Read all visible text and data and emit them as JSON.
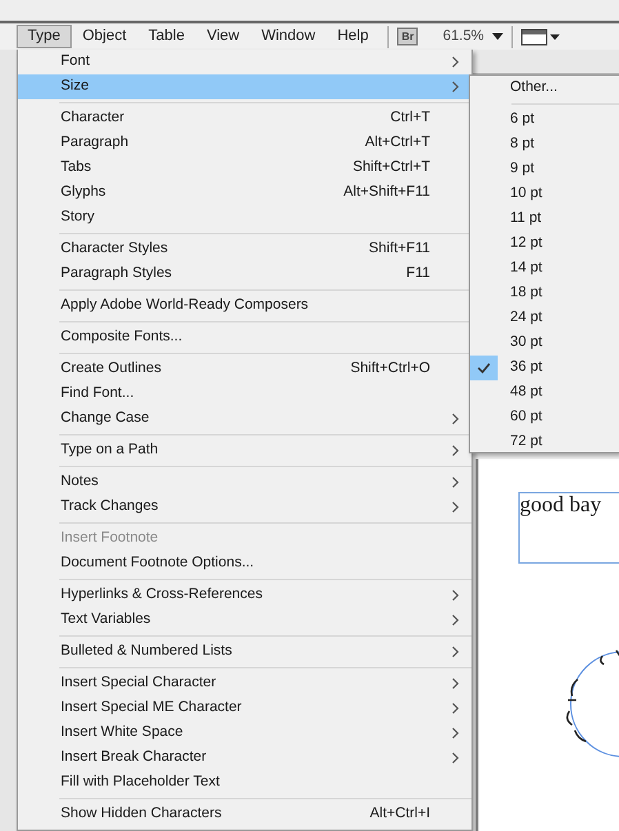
{
  "menubar": [
    {
      "label": "Type",
      "selected": true
    },
    {
      "label": "Object",
      "selected": false
    },
    {
      "label": "Table",
      "selected": false
    },
    {
      "label": "View",
      "selected": false
    },
    {
      "label": "Window",
      "selected": false
    },
    {
      "label": "Help",
      "selected": false
    }
  ],
  "toolbar": {
    "bridge_button": "Br",
    "zoom": "61.5%"
  },
  "menu": [
    {
      "kind": "item",
      "label": "Font",
      "submenu": true,
      "selected": false
    },
    {
      "kind": "item",
      "label": "Size",
      "submenu": true,
      "selected": true
    },
    {
      "kind": "separator"
    },
    {
      "kind": "item",
      "label": "Character",
      "shortcut": "Ctrl+T",
      "selected": false
    },
    {
      "kind": "item",
      "label": "Paragraph",
      "shortcut": "Alt+Ctrl+T",
      "selected": false
    },
    {
      "kind": "item",
      "label": "Tabs",
      "shortcut": "Shift+Ctrl+T",
      "selected": false
    },
    {
      "kind": "item",
      "label": "Glyphs",
      "shortcut": "Alt+Shift+F11",
      "selected": false
    },
    {
      "kind": "item",
      "label": "Story",
      "selected": false
    },
    {
      "kind": "separator"
    },
    {
      "kind": "item",
      "label": "Character Styles",
      "shortcut": "Shift+F11",
      "selected": false
    },
    {
      "kind": "item",
      "label": "Paragraph Styles",
      "shortcut": "F11",
      "selected": false
    },
    {
      "kind": "separator"
    },
    {
      "kind": "item",
      "label": "Apply Adobe World-Ready Composers",
      "selected": false
    },
    {
      "kind": "separator"
    },
    {
      "kind": "item",
      "label": "Composite Fonts...",
      "selected": false
    },
    {
      "kind": "separator"
    },
    {
      "kind": "item",
      "label": "Create Outlines",
      "shortcut": "Shift+Ctrl+O",
      "selected": false
    },
    {
      "kind": "item",
      "label": "Find Font...",
      "selected": false
    },
    {
      "kind": "item",
      "label": "Change Case",
      "submenu": true,
      "selected": false
    },
    {
      "kind": "separator"
    },
    {
      "kind": "item",
      "label": "Type on a Path",
      "submenu": true,
      "selected": false
    },
    {
      "kind": "separator"
    },
    {
      "kind": "item",
      "label": "Notes",
      "submenu": true,
      "selected": false
    },
    {
      "kind": "item",
      "label": "Track Changes",
      "submenu": true,
      "selected": false
    },
    {
      "kind": "separator"
    },
    {
      "kind": "item",
      "label": "Insert Footnote",
      "disabled": true,
      "selected": false
    },
    {
      "kind": "item",
      "label": "Document Footnote Options...",
      "selected": false
    },
    {
      "kind": "separator"
    },
    {
      "kind": "item",
      "label": "Hyperlinks & Cross-References",
      "submenu": true,
      "selected": false
    },
    {
      "kind": "item",
      "label": "Text Variables",
      "submenu": true,
      "selected": false
    },
    {
      "kind": "separator"
    },
    {
      "kind": "item",
      "label": "Bulleted & Numbered Lists",
      "submenu": true,
      "selected": false
    },
    {
      "kind": "separator"
    },
    {
      "kind": "item",
      "label": "Insert Special Character",
      "submenu": true,
      "selected": false
    },
    {
      "kind": "item",
      "label": "Insert Special ME Character",
      "submenu": true,
      "selected": false
    },
    {
      "kind": "item",
      "label": "Insert White Space",
      "submenu": true,
      "selected": false
    },
    {
      "kind": "item",
      "label": "Insert Break Character",
      "submenu": true,
      "selected": false
    },
    {
      "kind": "item",
      "label": "Fill with Placeholder Text",
      "selected": false
    },
    {
      "kind": "separator"
    },
    {
      "kind": "item",
      "label": "Show Hidden Characters",
      "shortcut": "Alt+Ctrl+I",
      "selected": false
    }
  ],
  "size_submenu": [
    {
      "kind": "item",
      "label": "Other...",
      "checked": false
    },
    {
      "kind": "separator"
    },
    {
      "kind": "item",
      "label": "6 pt",
      "checked": false
    },
    {
      "kind": "item",
      "label": "8 pt",
      "checked": false
    },
    {
      "kind": "item",
      "label": "9 pt",
      "checked": false
    },
    {
      "kind": "item",
      "label": "10 pt",
      "checked": false
    },
    {
      "kind": "item",
      "label": "11 pt",
      "checked": false
    },
    {
      "kind": "item",
      "label": "12 pt",
      "checked": false
    },
    {
      "kind": "item",
      "label": "14 pt",
      "checked": false
    },
    {
      "kind": "item",
      "label": "18 pt",
      "checked": false
    },
    {
      "kind": "item",
      "label": "24 pt",
      "checked": false
    },
    {
      "kind": "item",
      "label": "30 pt",
      "checked": false
    },
    {
      "kind": "item",
      "label": "36 pt",
      "checked": true
    },
    {
      "kind": "item",
      "label": "48 pt",
      "checked": false
    },
    {
      "kind": "item",
      "label": "60 pt",
      "checked": false
    },
    {
      "kind": "item",
      "label": "72 pt",
      "checked": false
    }
  ],
  "document": {
    "text_frame": "good bay"
  }
}
